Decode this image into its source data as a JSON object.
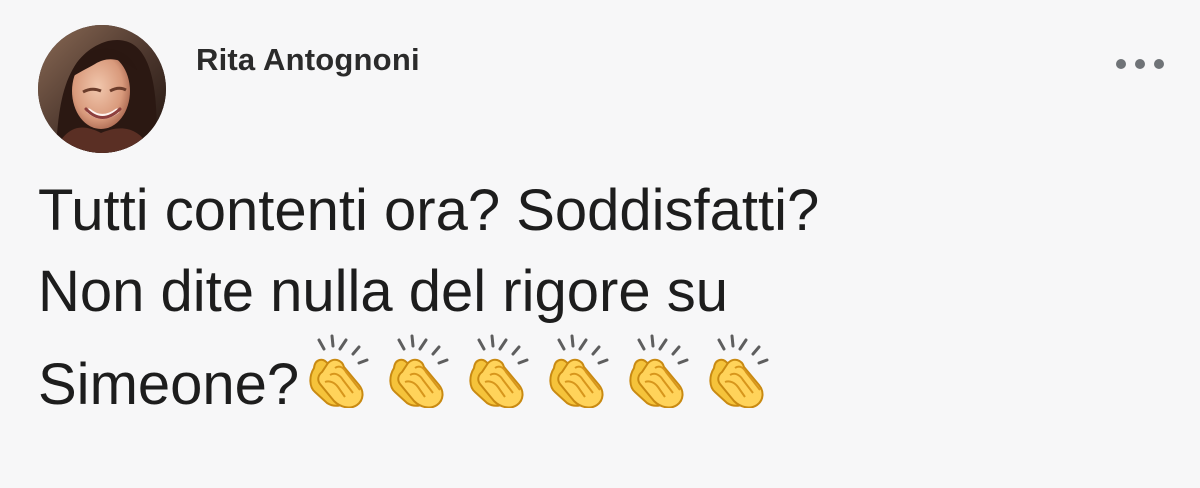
{
  "post": {
    "author_name": "Rita Antognoni",
    "text_lines": [
      "Tutti contenti ora? Soddisfatti?",
      "Non dite nulla del rigore su",
      "Simeone?"
    ],
    "emoji": {
      "name": "clapping-hands-icon",
      "count": 6
    },
    "more_icon": "more-options-icon"
  },
  "colors": {
    "background": "#f7f7f8",
    "text": "#1d1d1d",
    "icon_gray": "#6f7377",
    "emoji_yellow": "#f5c33b"
  }
}
